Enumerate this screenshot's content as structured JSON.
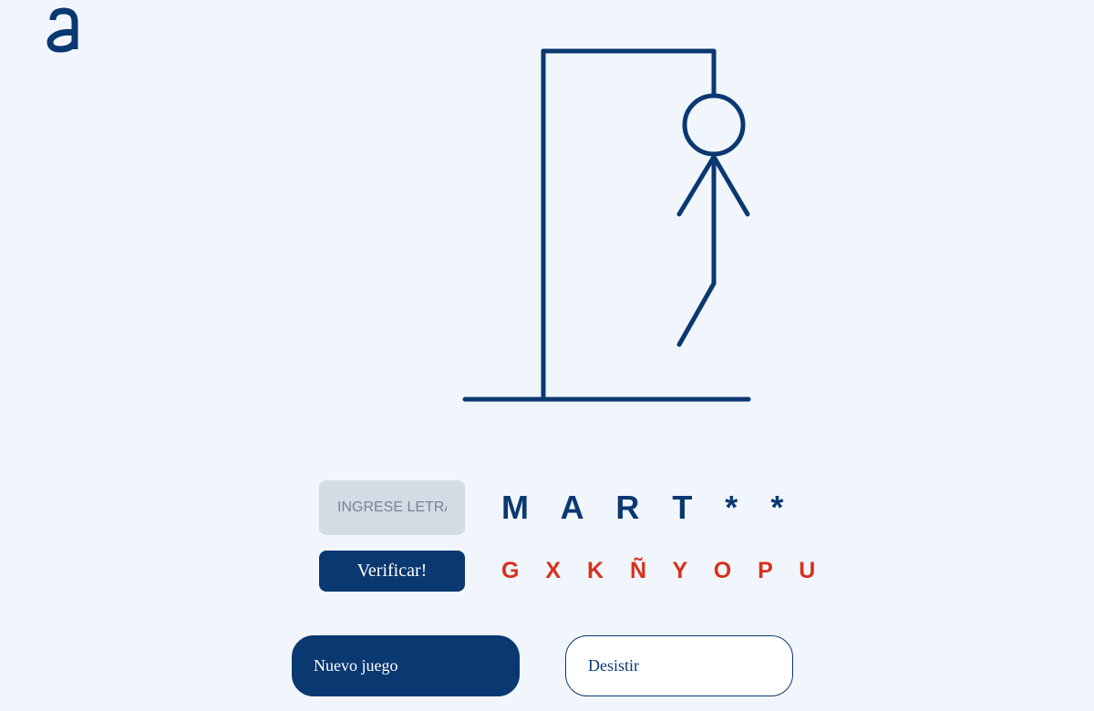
{
  "logo": {
    "icon": "alura-a-logo",
    "glyph": "a",
    "color": "#0a3871"
  },
  "input": {
    "placeholder": "INGRESE LETRA",
    "value": ""
  },
  "verify_button": {
    "label": "Verificar!"
  },
  "word": {
    "display": "M A R T * *"
  },
  "wrong_letters": {
    "display": "G X K Ñ Y O P U"
  },
  "buttons": {
    "new_game": "Nuevo juego",
    "give_up": "Desistir"
  },
  "colors": {
    "primary": "#0a3871",
    "error": "#d6301c",
    "background": "#f1f5fc",
    "input_bg": "#d5dbe4"
  },
  "gallows": {
    "parts_shown": [
      "base",
      "pole",
      "beam",
      "rope",
      "head",
      "body",
      "left-arm",
      "right-arm",
      "left-leg"
    ]
  }
}
